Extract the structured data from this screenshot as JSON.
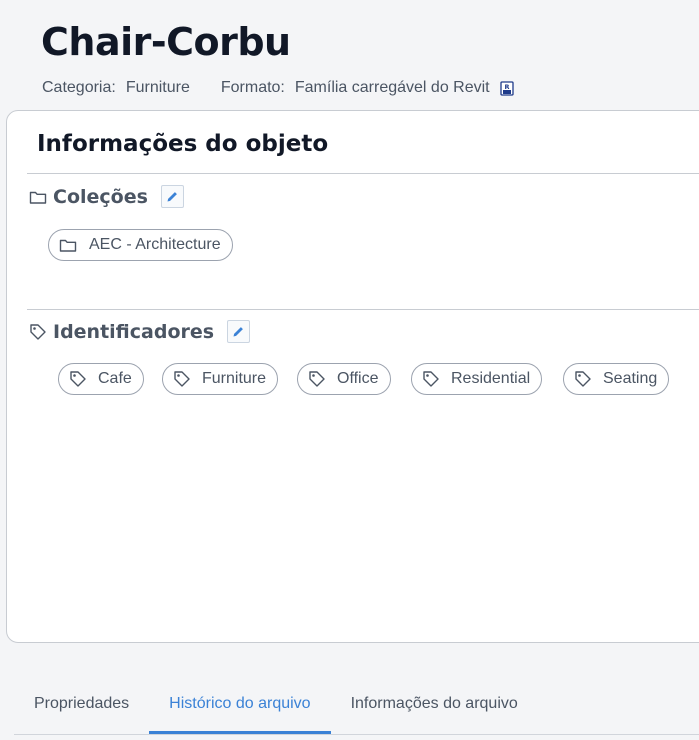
{
  "header": {
    "title": "Chair-Corbu",
    "category_label": "Categoria:",
    "category_value": "Furniture",
    "format_label": "Formato:",
    "format_value": "Família carregável do Revit",
    "format_icon": "revit-file-icon"
  },
  "panel": {
    "title": "Informações do objeto",
    "collections": {
      "label": "Coleções",
      "icon": "folder-icon",
      "edit_icon": "pencil-icon",
      "items": [
        "AEC - Architecture"
      ]
    },
    "tags": {
      "label": "Identificadores",
      "icon": "tag-icon",
      "edit_icon": "pencil-icon",
      "items": [
        "Cafe",
        "Furniture",
        "Office",
        "Residential",
        "Seating"
      ]
    }
  },
  "tabs": [
    {
      "label": "Propriedades",
      "active": false
    },
    {
      "label": "Histórico do arquivo",
      "active": true
    },
    {
      "label": "Informações do arquivo",
      "active": false
    }
  ],
  "colors": {
    "accent": "#3b82d6",
    "text_primary": "#111827",
    "text_secondary": "#4b5563",
    "border": "#c8ccd2",
    "background": "#f4f5f7"
  }
}
